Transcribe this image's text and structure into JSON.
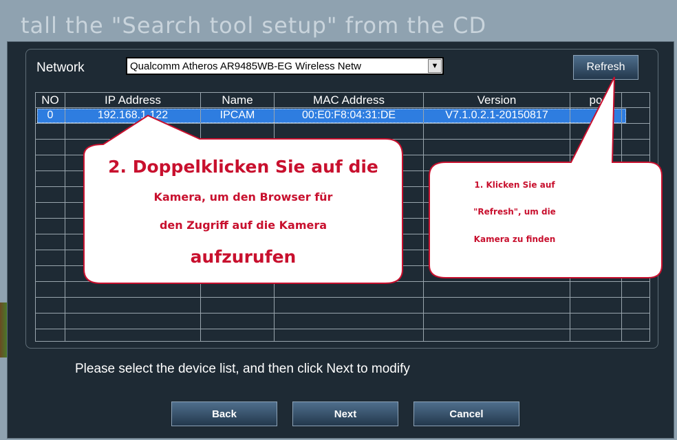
{
  "background": {
    "text": "tall the \"Search tool  setup\" from the CD"
  },
  "network": {
    "label": "Network",
    "selected_adapter": "Qualcomm Atheros AR9485WB-EG Wireless Netw"
  },
  "buttons": {
    "refresh": "Refresh",
    "back": "Back",
    "next": "Next",
    "cancel": "Cancel"
  },
  "table": {
    "columns": [
      "NO",
      "IP Address",
      "Name",
      "MAC Address",
      "Version",
      "po"
    ],
    "rows": [
      {
        "no": "0",
        "ip": "192.168.1.122",
        "name": "IPCAM",
        "mac": "00:E0:F8:04:31:DE",
        "version": "V7.1.0.2.1-20150817",
        "port": ""
      }
    ]
  },
  "hint": "Please select the device list, and then click Next to modify",
  "callouts": {
    "double_click": {
      "line1": "2. Doppelklicken Sie auf die",
      "line2": "Kamera, um den Browser für",
      "line3": "den Zugriff auf die Kamera",
      "line4": "aufzurufen"
    },
    "refresh_hint": {
      "line1": "1. Klicken Sie auf",
      "line2": "\"Refresh\", um die",
      "line3": "Kamera zu finden"
    }
  },
  "colors": {
    "dialog_bg": "#1e2a34",
    "selection": "#2e7de0",
    "callout_text": "#c8102e",
    "callout_border": "#c8102e"
  }
}
